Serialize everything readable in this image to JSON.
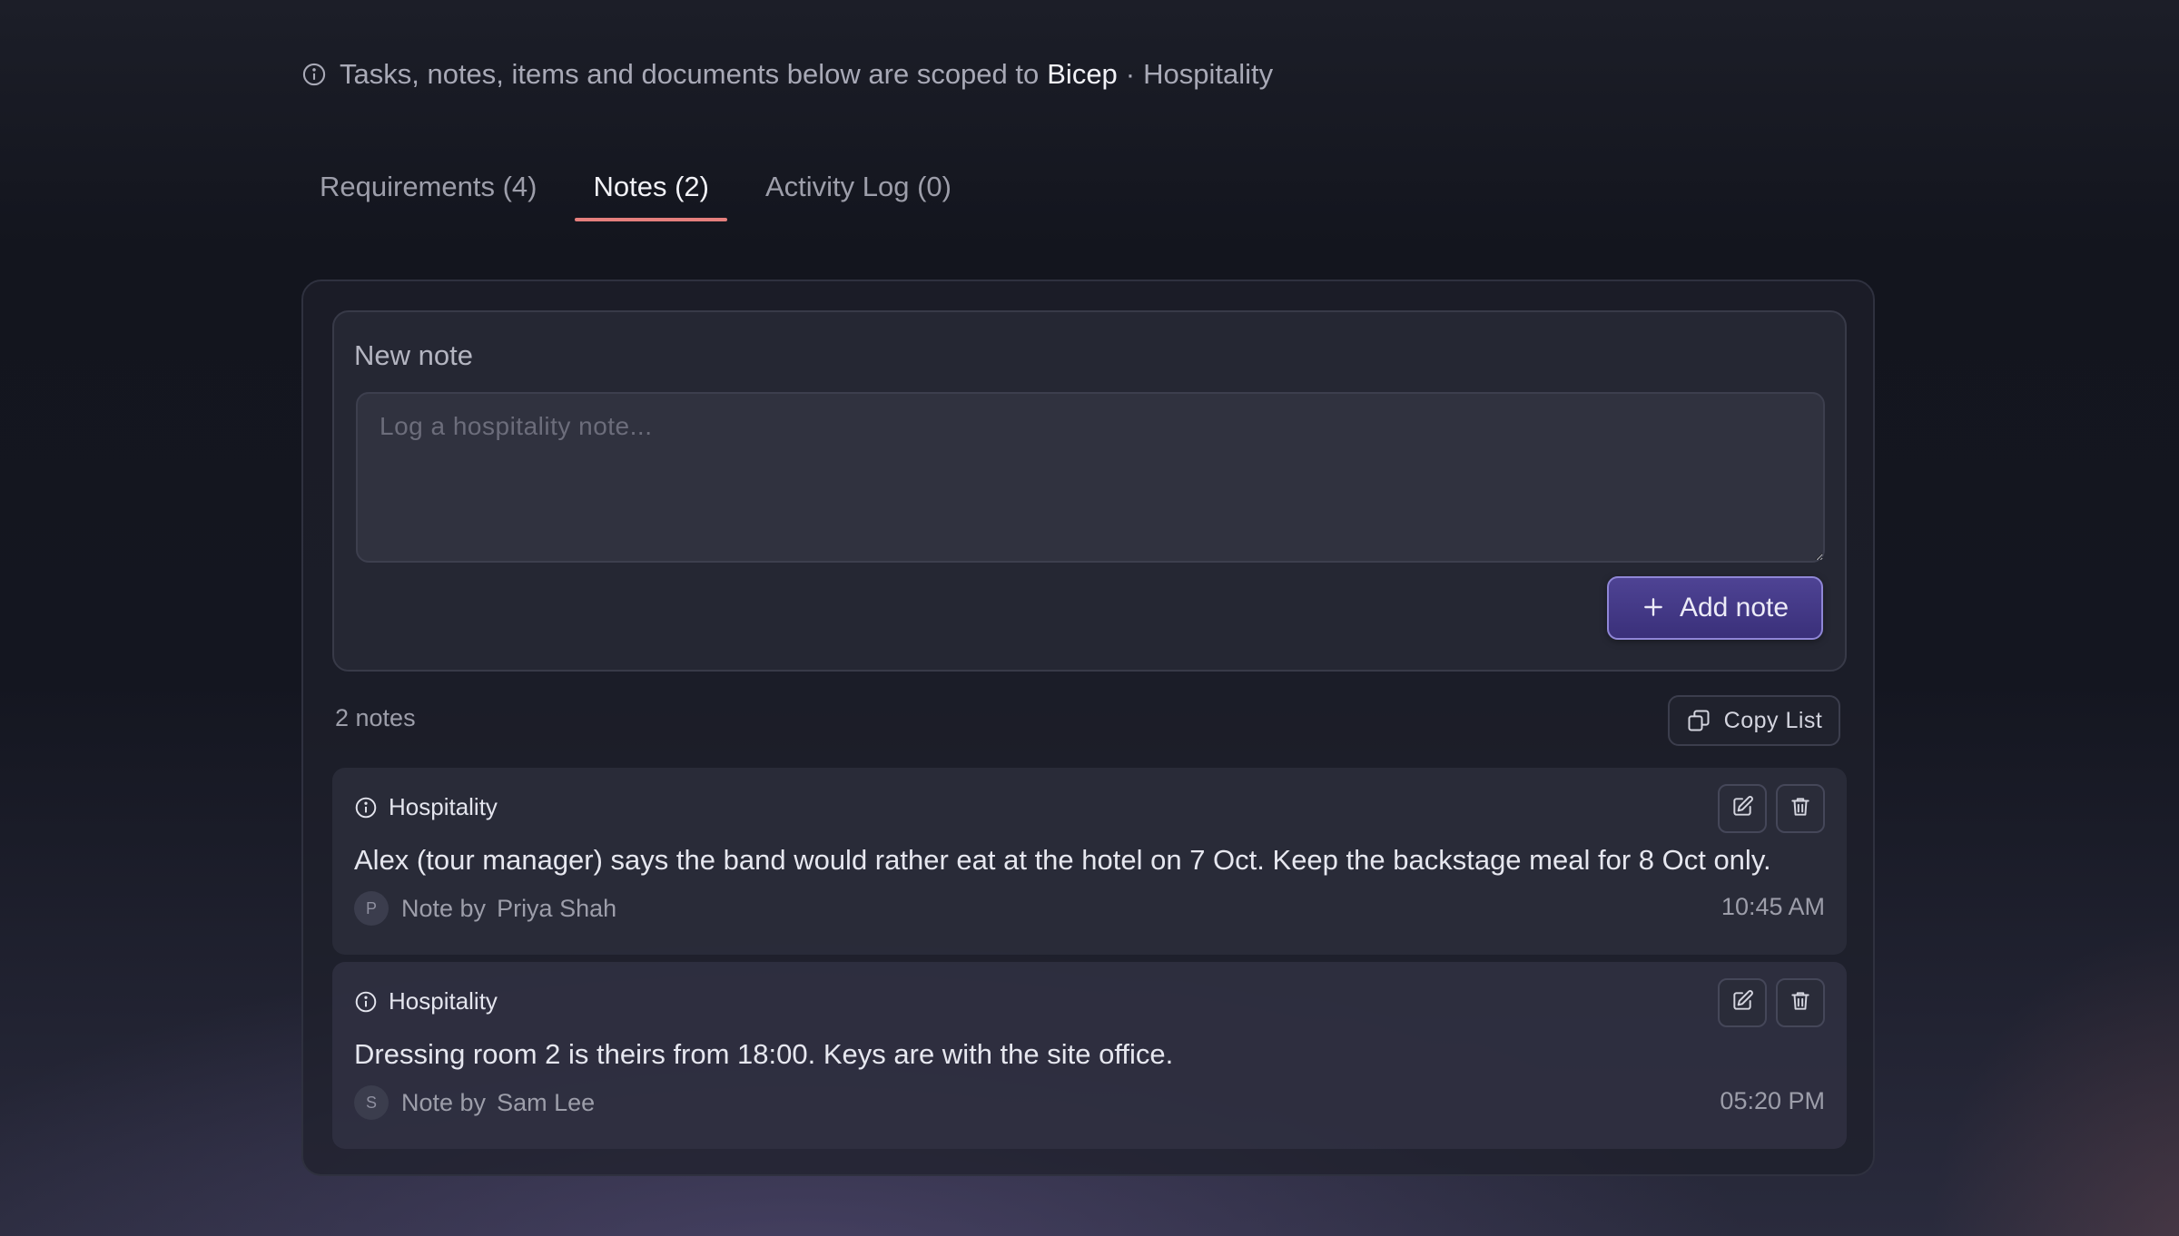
{
  "scope_banner": {
    "icon": "info-icon",
    "prefix": "Tasks, notes, items and documents below are scoped to",
    "entity": "Bicep",
    "separator": "·",
    "context": "Hospitality"
  },
  "tabs": [
    {
      "label": "Requirements (4)",
      "active": false
    },
    {
      "label": "Notes (2)",
      "active": true
    },
    {
      "label": "Activity Log (0)",
      "active": false
    }
  ],
  "colors": {
    "accent_tab_underline": "#e57f7d",
    "primary_button": "#4e4394"
  },
  "composer": {
    "title": "New note",
    "placeholder": "Log a hospitality note...",
    "value": "",
    "add_button_icon": "plus-icon",
    "add_button_label": "Add note"
  },
  "list": {
    "count_label": "2 notes",
    "copy_button_icon": "copy-icon",
    "copy_button_label": "Copy List"
  },
  "notes": [
    {
      "category_icon": "info-icon",
      "category": "Hospitality",
      "text": "Alex (tour manager) says the band would rather eat at the hotel on 7 Oct. Keep the backstage meal for 8 Oct only.",
      "avatar_initial": "P",
      "by_label": "Note by",
      "author": "Priya Shah",
      "time": "10:45 AM",
      "edit_icon": "edit-icon",
      "delete_icon": "trash-icon"
    },
    {
      "category_icon": "info-icon",
      "category": "Hospitality",
      "text": "Dressing room 2 is theirs from 18:00. Keys are with the site office.",
      "avatar_initial": "S",
      "by_label": "Note by",
      "author": "Sam Lee",
      "time": "05:20 PM",
      "edit_icon": "edit-icon",
      "delete_icon": "trash-icon"
    }
  ]
}
